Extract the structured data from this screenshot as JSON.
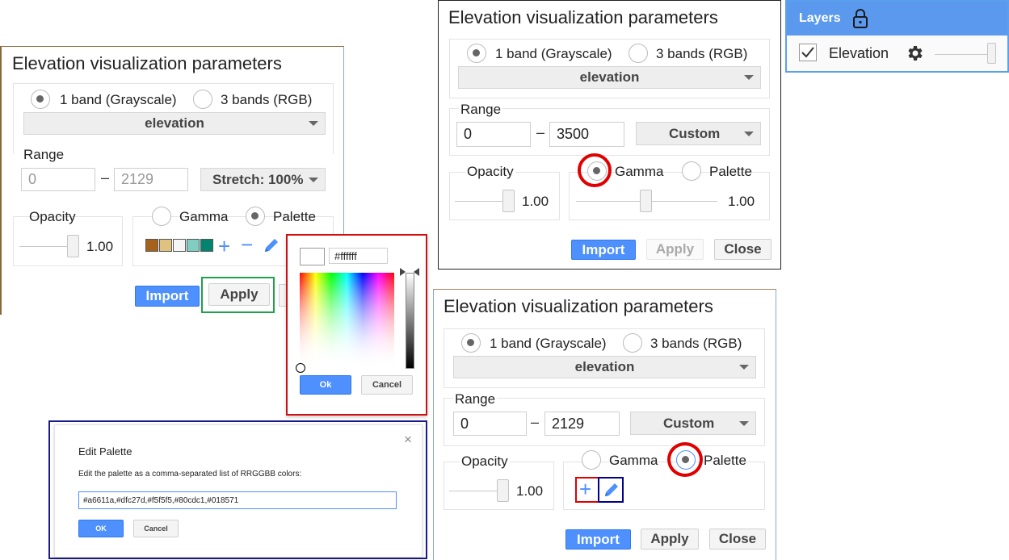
{
  "panel_a": {
    "title": "Elevation visualization parameters",
    "band_one": "1 band (Grayscale)",
    "band_three": "3 bands (RGB)",
    "band_select": "elevation",
    "range_label": "Range",
    "range_min": "0",
    "range_max": "2129",
    "stretch": "Stretch: 100%",
    "opacity_label": "Opacity",
    "opacity_value": "1.00",
    "gamma_label": "Gamma",
    "palette_label": "Palette",
    "palette_colors": [
      "#a6611a",
      "#dfc27d",
      "#f5f5f5",
      "#80cdc1",
      "#018571"
    ],
    "import": "Import",
    "apply": "Apply"
  },
  "picker": {
    "hex": "#ffffff",
    "ok": "Ok",
    "cancel": "Cancel"
  },
  "edit_palette": {
    "title": "Edit Palette",
    "close": "×",
    "instruction": "Edit the palette as a comma-separated list of RRGGBB colors:",
    "value": "#a6611a,#dfc27d,#f5f5f5,#80cdc1,#018571",
    "ok": "OK",
    "cancel": "Cancel"
  },
  "panel_b": {
    "title": "Elevation visualization parameters",
    "band_one": "1 band (Grayscale)",
    "band_three": "3 bands (RGB)",
    "band_select": "elevation",
    "range_label": "Range",
    "range_min": "0",
    "range_max": "3500",
    "stretch": "Custom",
    "opacity_label": "Opacity",
    "opacity_value": "1.00",
    "gamma_label": "Gamma",
    "gamma_value": "1.00",
    "palette_label": "Palette",
    "import": "Import",
    "apply": "Apply",
    "close": "Close"
  },
  "layers": {
    "title": "Layers",
    "layer_name": "Elevation",
    "opacity": 1.0
  },
  "panel_c": {
    "title": "Elevation visualization parameters",
    "band_one": "1 band (Grayscale)",
    "band_three": "3 bands (RGB)",
    "band_select": "elevation",
    "range_label": "Range",
    "range_min": "0",
    "range_max": "2129",
    "stretch": "Custom",
    "opacity_label": "Opacity",
    "opacity_value": "1.00",
    "gamma_label": "Gamma",
    "palette_label": "Palette",
    "import": "Import",
    "apply": "Apply",
    "close": "Close"
  },
  "colors": {
    "primary": "#4d90fe",
    "highlight_red": "#e00000",
    "highlight_green": "#22a04a",
    "highlight_navy": "#00008b"
  }
}
